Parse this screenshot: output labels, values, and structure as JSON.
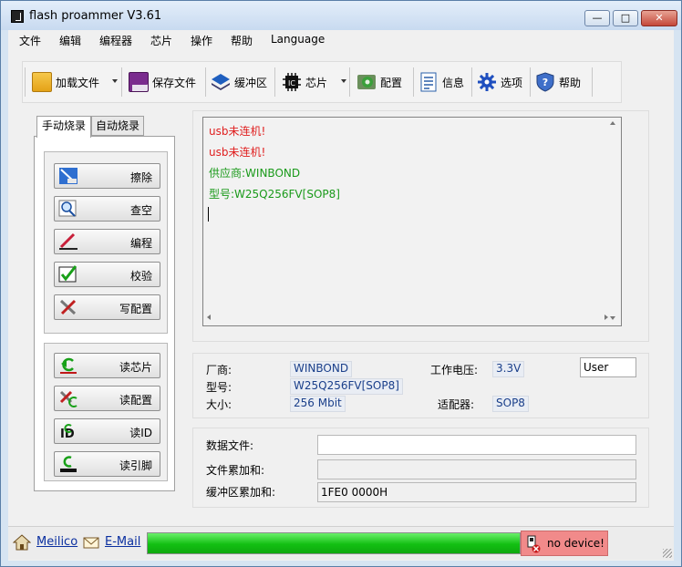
{
  "window": {
    "title": "flash proammer V3.61"
  },
  "menu": [
    "文件",
    "编辑",
    "编程器",
    "芯片",
    "操作",
    "帮助",
    "Language"
  ],
  "toolbar": {
    "load_file": "加载文件",
    "save_file": "保存文件",
    "buffer": "缓冲区",
    "chip": "芯片",
    "config": "配置",
    "info": "信息",
    "options": "选项",
    "help": "帮助"
  },
  "tabs": {
    "manual": "手动烧录",
    "auto": "自动烧录"
  },
  "buttons": {
    "erase": "擦除",
    "blank_check": "查空",
    "program": "编程",
    "verify": "校验",
    "write_config": "写配置",
    "read_chip": "读芯片",
    "read_config": "读配置",
    "read_id": "读ID",
    "read_pins": "读引脚"
  },
  "log": [
    {
      "text": "usb未连机!",
      "color": "#e02020"
    },
    {
      "text": "usb未连机!",
      "color": "#e02020"
    },
    {
      "text": "供应商:WINBOND",
      "color": "#1a9a1a"
    },
    {
      "text": "型号:W25Q256FV[SOP8]",
      "color": "#1a9a1a"
    }
  ],
  "info": {
    "vendor_label": "厂商:",
    "vendor": "WINBOND",
    "model_label": "型号:",
    "model": "W25Q256FV[SOP8]",
    "size_label": "大小:",
    "size": "256 Mbit",
    "voltage_label": "工作电压:",
    "voltage": "3.3V",
    "adapter_label": "适配器:",
    "adapter": "SOP8",
    "user": "User"
  },
  "file": {
    "data_file_label": "数据文件:",
    "data_file": "",
    "file_checksum_label": "文件累加和:",
    "file_checksum": "",
    "buffer_checksum_label": "缓冲区累加和:",
    "buffer_checksum": "1FE0 0000H"
  },
  "status": {
    "meilico": "Meilico",
    "email": "E-Mail",
    "progress": 1.0,
    "device": "no device!"
  }
}
